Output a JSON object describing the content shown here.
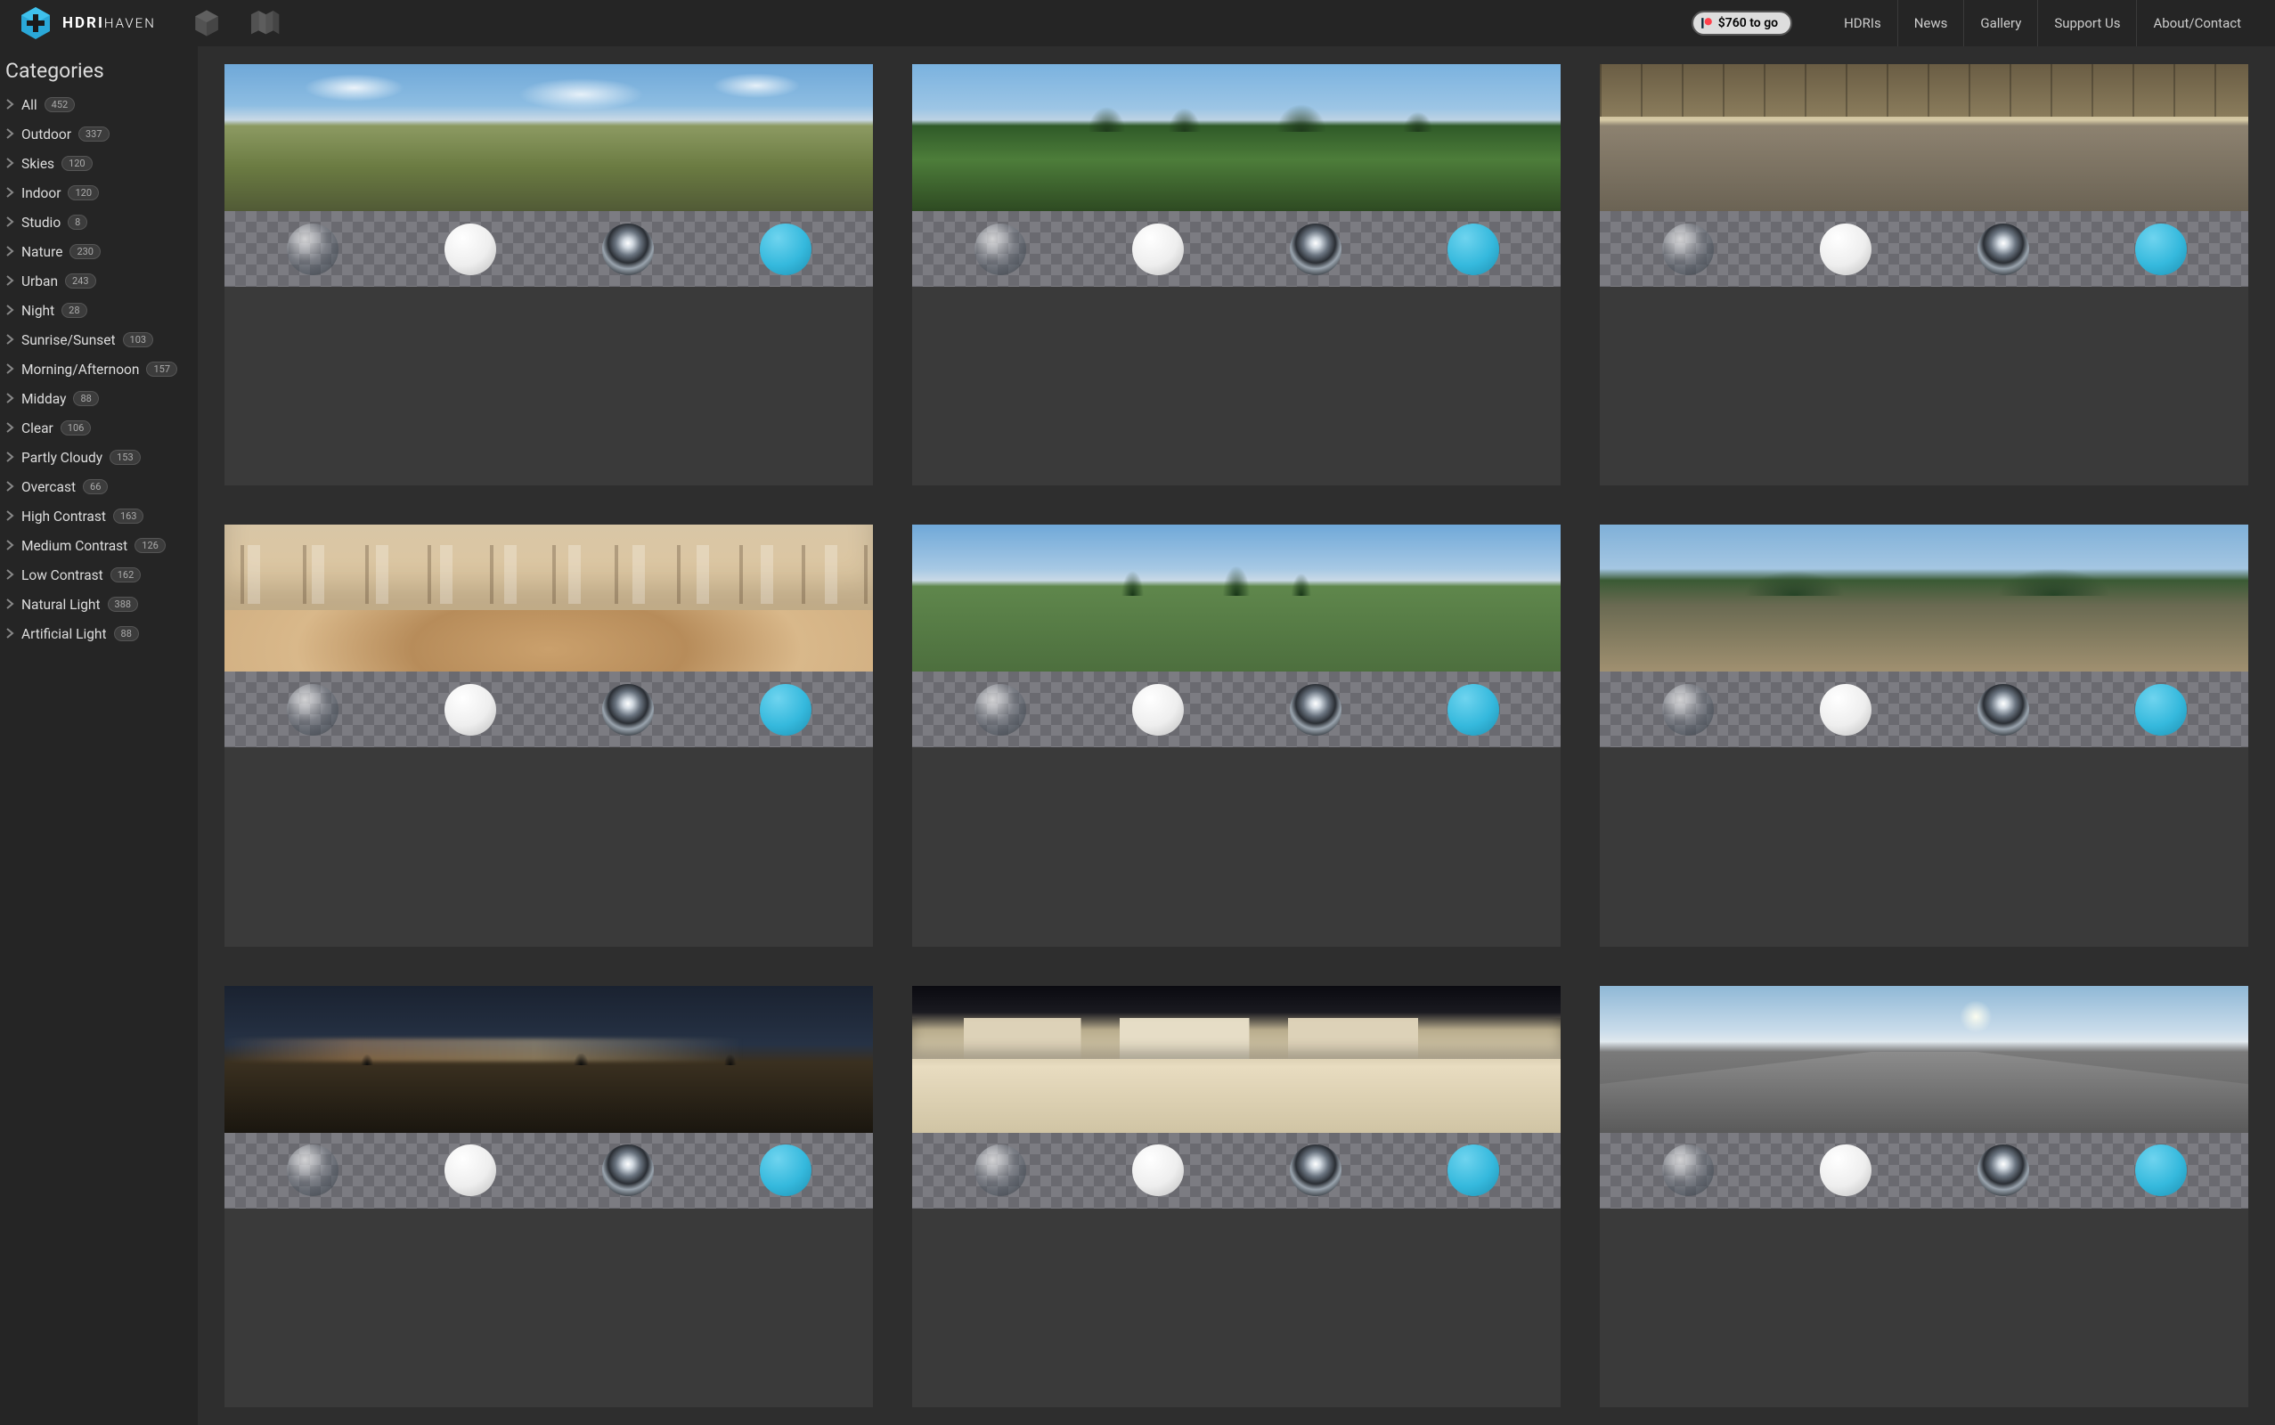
{
  "brand": {
    "bold": "HDRI",
    "light": "HAVEN"
  },
  "goal_text": "$760 to go",
  "nav": [
    "HDRIs",
    "News",
    "Gallery",
    "Support Us",
    "About/Contact"
  ],
  "sidebar_title": "Categories",
  "categories": [
    {
      "label": "All",
      "count": "452"
    },
    {
      "label": "Outdoor",
      "count": "337"
    },
    {
      "label": "Skies",
      "count": "120"
    },
    {
      "label": "Indoor",
      "count": "120"
    },
    {
      "label": "Studio",
      "count": "8"
    },
    {
      "label": "Nature",
      "count": "230"
    },
    {
      "label": "Urban",
      "count": "243"
    },
    {
      "label": "Night",
      "count": "28"
    },
    {
      "label": "Sunrise/Sunset",
      "count": "103"
    },
    {
      "label": "Morning/Afternoon",
      "count": "157"
    },
    {
      "label": "Midday",
      "count": "88"
    },
    {
      "label": "Clear",
      "count": "106"
    },
    {
      "label": "Partly Cloudy",
      "count": "153"
    },
    {
      "label": "Overcast",
      "count": "66"
    },
    {
      "label": "High Contrast",
      "count": "163"
    },
    {
      "label": "Medium Contrast",
      "count": "126"
    },
    {
      "label": "Low Contrast",
      "count": "162"
    },
    {
      "label": "Natural Light",
      "count": "388"
    },
    {
      "label": "Artificial Light",
      "count": "88"
    }
  ],
  "cards": [
    {
      "pano": "sky-field"
    },
    {
      "pano": "meadow"
    },
    {
      "pano": "warehouse"
    },
    {
      "pano": "interior"
    },
    {
      "pano": "alpine"
    },
    {
      "pano": "cliff"
    },
    {
      "pano": "night-plain"
    },
    {
      "pano": "snow-town"
    },
    {
      "pano": "highway"
    }
  ],
  "sphere_kinds": [
    "glass",
    "white",
    "chrome",
    "blue"
  ]
}
